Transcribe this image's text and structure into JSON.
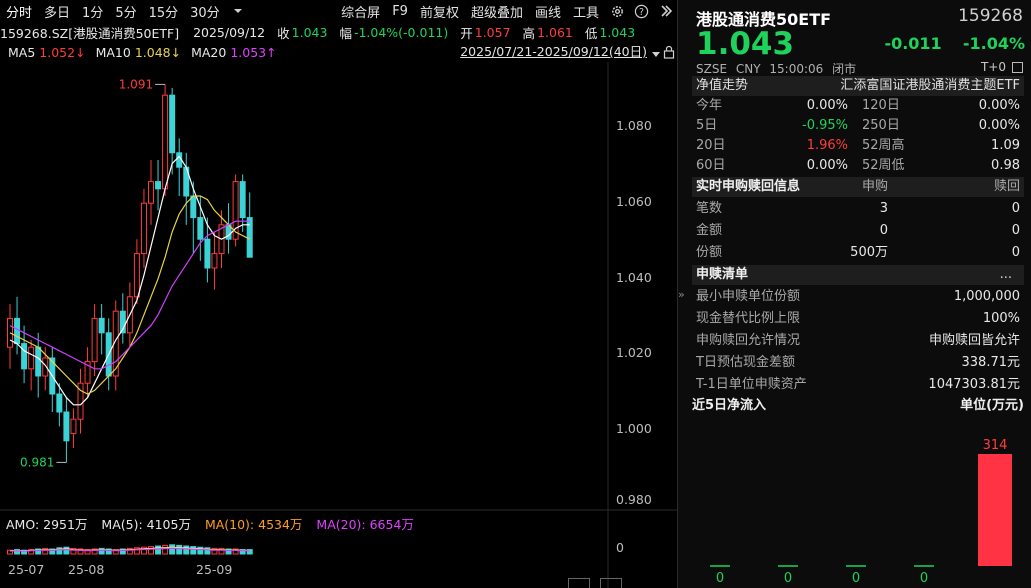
{
  "toolbar": {
    "periods": [
      "分时",
      "多日",
      "1分",
      "5分",
      "15分",
      "30分"
    ],
    "right_items": [
      "综合屏",
      "F9",
      "前复权",
      "超级叠加",
      "画线",
      "工具"
    ]
  },
  "infobar": {
    "code_name": "159268.SZ[港股通消费50ETF]",
    "date": "2025/09/12",
    "close_label": "收",
    "close": "1.043",
    "change_label": "幅",
    "change": "-1.04%(-0.011)",
    "open_label": "开",
    "open": "1.057",
    "high_label": "高",
    "high": "1.061",
    "low_label": "低",
    "low": "1.043"
  },
  "ma": {
    "ma5_label": "MA5",
    "ma5": "1.052↓",
    "ma10_label": "MA10",
    "ma10": "1.048↓",
    "ma20_label": "MA20",
    "ma20": "1.053↑",
    "range": "2025/07/21-2025/09/12(40日)"
  },
  "volume_bar": {
    "amo": "AMO: 2951万",
    "ma5": "MA(5): 4105万",
    "ma10": "MA(10): 4534万",
    "ma20": "MA(20): 6654万",
    "zero": "0"
  },
  "x_labels": [
    "25-07",
    "25-08",
    "25-09"
  ],
  "chart_data": {
    "type": "candlestick",
    "ylim": [
      0.975,
      1.095
    ],
    "yticks": [
      "1.080",
      "1.060",
      "1.040",
      "1.020",
      "1.000",
      "0.980"
    ],
    "annotations": {
      "max": "1.091",
      "min": "0.981"
    },
    "candles": [
      [
        1.018,
        1.026,
        1.03,
        1.012
      ],
      [
        1.026,
        1.019,
        1.032,
        1.016
      ],
      [
        1.019,
        1.012,
        1.024,
        1.008
      ],
      [
        1.012,
        1.018,
        1.02,
        1.006
      ],
      [
        1.018,
        1.01,
        1.022,
        1.004
      ],
      [
        1.01,
        1.015,
        1.018,
        1.006
      ],
      [
        1.015,
        1.005,
        1.018,
        1.0
      ],
      [
        1.005,
        1.0,
        1.008,
        0.996
      ],
      [
        1.0,
        0.992,
        1.004,
        0.986
      ],
      [
        0.994,
        0.998,
        1.001,
        0.99
      ],
      [
        0.998,
        1.008,
        1.012,
        0.994
      ],
      [
        1.008,
        1.014,
        1.018,
        1.004
      ],
      [
        1.014,
        1.026,
        1.03,
        1.01
      ],
      [
        1.026,
        1.022,
        1.03,
        1.016
      ],
      [
        1.022,
        1.01,
        1.026,
        1.006
      ],
      [
        1.01,
        1.028,
        1.031,
        1.006
      ],
      [
        1.028,
        1.022,
        1.033,
        1.019
      ],
      [
        1.022,
        1.032,
        1.036,
        1.018
      ],
      [
        1.032,
        1.044,
        1.048,
        1.03
      ],
      [
        1.044,
        1.058,
        1.062,
        1.04
      ],
      [
        1.058,
        1.064,
        1.07,
        1.052
      ],
      [
        1.064,
        1.062,
        1.07,
        1.056
      ],
      [
        1.062,
        1.088,
        1.091,
        1.06
      ],
      [
        1.088,
        1.072,
        1.09,
        1.066
      ],
      [
        1.072,
        1.068,
        1.076,
        1.06
      ],
      [
        1.068,
        1.06,
        1.072,
        1.052
      ],
      [
        1.06,
        1.054,
        1.064,
        1.044
      ],
      [
        1.054,
        1.048,
        1.06,
        1.042
      ],
      [
        1.048,
        1.04,
        1.054,
        1.036
      ],
      [
        1.04,
        1.044,
        1.05,
        1.034
      ],
      [
        1.044,
        1.052,
        1.056,
        1.04
      ],
      [
        1.052,
        1.048,
        1.058,
        1.044
      ],
      [
        1.048,
        1.064,
        1.066,
        1.046
      ],
      [
        1.064,
        1.054,
        1.066,
        1.05
      ],
      [
        1.054,
        1.043,
        1.061,
        1.043
      ]
    ],
    "ma5": [
      1.02,
      1.019,
      1.017,
      1.016,
      1.015,
      1.013,
      1.01,
      1.007,
      1.004,
      1.002,
      1.002,
      1.004,
      1.008,
      1.012,
      1.016,
      1.02,
      1.023,
      1.027,
      1.031,
      1.038,
      1.046,
      1.054,
      1.062,
      1.069,
      1.071,
      1.068,
      1.062,
      1.057,
      1.052,
      1.049,
      1.048,
      1.049,
      1.051,
      1.052,
      1.052
    ],
    "ma10": [
      1.022,
      1.021,
      1.02,
      1.019,
      1.018,
      1.016,
      1.014,
      1.012,
      1.01,
      1.008,
      1.006,
      1.005,
      1.006,
      1.008,
      1.01,
      1.012,
      1.015,
      1.018,
      1.022,
      1.027,
      1.032,
      1.037,
      1.043,
      1.05,
      1.055,
      1.058,
      1.06,
      1.06,
      1.059,
      1.056,
      1.054,
      1.052,
      1.05,
      1.049,
      1.048
    ],
    "ma20": [
      1.024,
      1.023,
      1.022,
      1.021,
      1.02,
      1.019,
      1.018,
      1.017,
      1.016,
      1.015,
      1.014,
      1.013,
      1.012,
      1.012,
      1.013,
      1.014,
      1.016,
      1.018,
      1.02,
      1.022,
      1.024,
      1.027,
      1.031,
      1.035,
      1.038,
      1.041,
      1.044,
      1.047,
      1.049,
      1.05,
      1.051,
      1.052,
      1.053,
      1.053,
      1.053
    ],
    "volume_ma": [
      0.3,
      0.4,
      0.3,
      0.4,
      0.5,
      0.6,
      0.5,
      0.7,
      0.8,
      0.6,
      0.5,
      0.4,
      0.5,
      0.6,
      0.5,
      0.4,
      0.5,
      0.6,
      0.7,
      0.8,
      0.9,
      1.0,
      1.1,
      1.2,
      1.1,
      1.0,
      0.9,
      0.8,
      0.7,
      0.6,
      0.6,
      0.5,
      0.5,
      0.4,
      0.4
    ]
  },
  "quote": {
    "title": "港股通消费50ETF",
    "code": "159268",
    "price": "1.043",
    "change": "-0.011",
    "change_pct": "-1.04%",
    "market": "SZSE",
    "currency": "CNY",
    "time": "15:00:06",
    "status": "闭市",
    "t0": "T+0"
  },
  "nav": {
    "header_label": "净值走势",
    "header_value": "汇添富国证港股通消费主题ETF",
    "rows": [
      {
        "l1": "今年",
        "v1": "0.00%",
        "c1": "white",
        "l2": "120日",
        "v2": "0.00%"
      },
      {
        "l1": "5日",
        "v1": "-0.95%",
        "c1": "green",
        "l2": "250日",
        "v2": "0.00%"
      },
      {
        "l1": "20日",
        "v1": "1.96%",
        "c1": "red",
        "l2": "52周高",
        "v2": "1.09"
      },
      {
        "l1": "60日",
        "v1": "0.00%",
        "c1": "white",
        "l2": "52周低",
        "v2": "0.98"
      }
    ]
  },
  "realtime": {
    "header": "实时申购赎回信息",
    "col1": "申购",
    "col2": "赎回",
    "rows": [
      {
        "label": "笔数",
        "v1": "3",
        "v2": "0"
      },
      {
        "label": "金额",
        "v1": "0",
        "v2": "0"
      },
      {
        "label": "份额",
        "v1": "500万",
        "v2": "0"
      }
    ]
  },
  "redeem": {
    "header": "申赎清单",
    "more": "...",
    "rows": [
      {
        "label": "最小申赎单位份额",
        "value": "1,000,000"
      },
      {
        "label": "现金替代比例上限",
        "value": "100%"
      },
      {
        "label": "申购赎回允许情况",
        "value": "申购赎回皆允许"
      },
      {
        "label": "T日预估现金差额",
        "value": "338.71元"
      },
      {
        "label": "T-1日单位申赎资产",
        "value": "1047303.81元"
      }
    ]
  },
  "inflow": {
    "header": "近5日净流入",
    "unit": "单位(万元)",
    "chart_data": {
      "type": "bar",
      "values": [
        0,
        0,
        0,
        0,
        314
      ],
      "labels": [
        "0",
        "0",
        "0",
        "0",
        "314"
      ]
    }
  }
}
